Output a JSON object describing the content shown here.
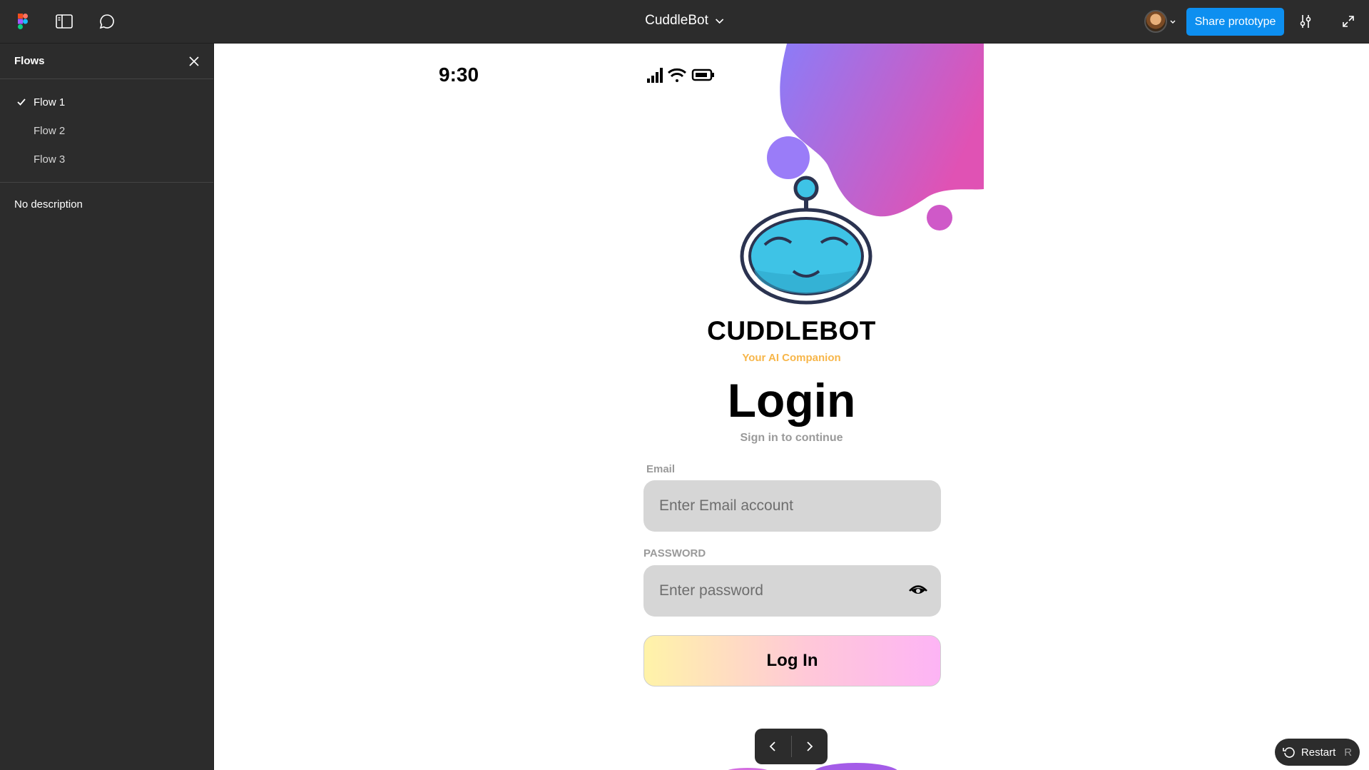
{
  "topbar": {
    "title": "CuddleBot",
    "share_label": "Share prototype",
    "icons": [
      "figma-logo-icon",
      "sidebar-toggle-icon",
      "comment-icon",
      "chevron-down-icon",
      "settings-icon",
      "expand-icon"
    ]
  },
  "sidebar": {
    "title": "Flows",
    "flows": [
      {
        "label": "Flow 1",
        "active": true
      },
      {
        "label": "Flow 2",
        "active": false
      },
      {
        "label": "Flow 3",
        "active": false
      }
    ],
    "description": "No description"
  },
  "phone": {
    "time": "9:30",
    "brand_name": "CUDDLEBOT",
    "tagline": "Your AI Companion",
    "login_title": "Login",
    "subtitle": "Sign in to continue",
    "email_label": "Email",
    "email_placeholder": "Enter Email account",
    "password_label": "PASSWORD",
    "password_placeholder": "Enter password",
    "login_button": "Log In"
  },
  "player": {
    "restart_label": "Restart",
    "restart_key": "R"
  },
  "colors": {
    "accent": "#0d8ff0",
    "tagline": "#f7b64a",
    "blob_start": "#8b7cf8",
    "blob_end": "#e052b4",
    "robot_face": "#3ec3e6"
  }
}
